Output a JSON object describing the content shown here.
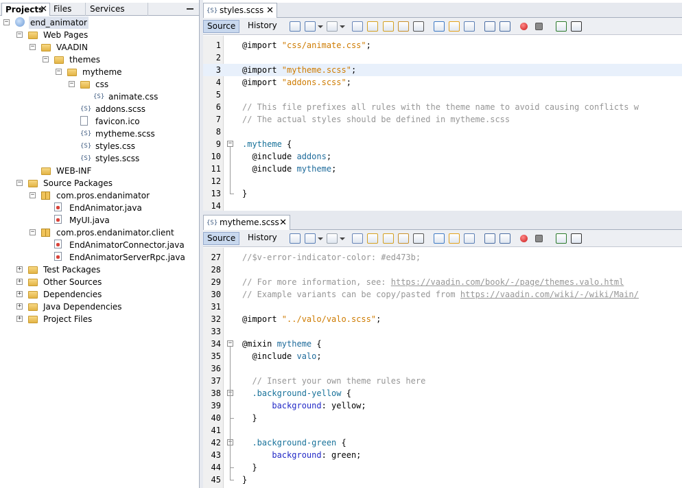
{
  "projects_panel": {
    "tabs": [
      "Projects",
      "Files",
      "Services"
    ],
    "close_glyph": "✕",
    "tree": [
      {
        "label": "end_animator",
        "indent": 0,
        "toggle": "−",
        "icon": "project",
        "selected": true
      },
      {
        "label": "Web Pages",
        "indent": 1,
        "toggle": "−",
        "icon": "folder-web"
      },
      {
        "label": "VAADIN",
        "indent": 2,
        "toggle": "−",
        "icon": "folder"
      },
      {
        "label": "themes",
        "indent": 3,
        "toggle": "−",
        "icon": "folder"
      },
      {
        "label": "mytheme",
        "indent": 4,
        "toggle": "−",
        "icon": "folder"
      },
      {
        "label": "css",
        "indent": 5,
        "toggle": "−",
        "icon": "folder"
      },
      {
        "label": "animate.css",
        "indent": 6,
        "toggle": "",
        "icon": "css-file"
      },
      {
        "label": "addons.scss",
        "indent": 5,
        "toggle": "",
        "icon": "scss-file"
      },
      {
        "label": "favicon.ico",
        "indent": 5,
        "toggle": "",
        "icon": "file"
      },
      {
        "label": "mytheme.scss",
        "indent": 5,
        "toggle": "",
        "icon": "scss-file"
      },
      {
        "label": "styles.css",
        "indent": 5,
        "toggle": "",
        "icon": "css-file"
      },
      {
        "label": "styles.scss",
        "indent": 5,
        "toggle": "",
        "icon": "scss-file"
      },
      {
        "label": "WEB-INF",
        "indent": 2,
        "toggle": "",
        "icon": "folder"
      },
      {
        "label": "Source Packages",
        "indent": 1,
        "toggle": "−",
        "icon": "folder-src"
      },
      {
        "label": "com.pros.endanimator",
        "indent": 2,
        "toggle": "−",
        "icon": "package"
      },
      {
        "label": "EndAnimator.java",
        "indent": 3,
        "toggle": "",
        "icon": "java-file"
      },
      {
        "label": "MyUI.java",
        "indent": 3,
        "toggle": "",
        "icon": "java-file"
      },
      {
        "label": "com.pros.endanimator.client",
        "indent": 2,
        "toggle": "−",
        "icon": "package"
      },
      {
        "label": "EndAnimatorConnector.java",
        "indent": 3,
        "toggle": "",
        "icon": "java-file"
      },
      {
        "label": "EndAnimatorServerRpc.java",
        "indent": 3,
        "toggle": "",
        "icon": "java-file"
      },
      {
        "label": "Test Packages",
        "indent": 1,
        "toggle": "+",
        "icon": "folder-test"
      },
      {
        "label": "Other Sources",
        "indent": 1,
        "toggle": "+",
        "icon": "folder-src"
      },
      {
        "label": "Dependencies",
        "indent": 1,
        "toggle": "+",
        "icon": "folder-lib"
      },
      {
        "label": "Java Dependencies",
        "indent": 1,
        "toggle": "+",
        "icon": "folder-lib"
      },
      {
        "label": "Project Files",
        "indent": 1,
        "toggle": "+",
        "icon": "folder-files"
      }
    ]
  },
  "editor_top": {
    "tab_title": "styles.scss",
    "source_label": "Source",
    "history_label": "History",
    "lines": [
      {
        "n": "1",
        "fold": "",
        "hl": false,
        "tokens": [
          [
            "kw",
            "@import "
          ],
          [
            "str",
            "\"css/animate.css\""
          ],
          [
            "kw",
            ";"
          ]
        ]
      },
      {
        "n": "2",
        "fold": "",
        "hl": false,
        "tokens": []
      },
      {
        "n": "3",
        "fold": "",
        "hl": true,
        "tokens": [
          [
            "kw",
            "@import "
          ],
          [
            "str",
            "\"mytheme.scss\""
          ],
          [
            "kw",
            ";"
          ]
        ]
      },
      {
        "n": "4",
        "fold": "",
        "hl": false,
        "tokens": [
          [
            "kw",
            "@import "
          ],
          [
            "str",
            "\"addons.scss\""
          ],
          [
            "kw",
            ";"
          ]
        ]
      },
      {
        "n": "5",
        "fold": "",
        "hl": false,
        "tokens": []
      },
      {
        "n": "6",
        "fold": "",
        "hl": false,
        "tokens": [
          [
            "cm",
            "// This file prefixes all rules with the theme name to avoid causing conflicts w"
          ]
        ]
      },
      {
        "n": "7",
        "fold": "",
        "hl": false,
        "tokens": [
          [
            "cm",
            "// The actual styles should be defined in mytheme.scss"
          ]
        ]
      },
      {
        "n": "8",
        "fold": "",
        "hl": false,
        "tokens": []
      },
      {
        "n": "9",
        "fold": "open",
        "hl": false,
        "tokens": [
          [
            "cls",
            ".mytheme"
          ],
          [
            "kw",
            " {"
          ]
        ]
      },
      {
        "n": "10",
        "fold": "",
        "hl": false,
        "tokens": [
          [
            "kw",
            "  @include "
          ],
          [
            "id",
            "addons"
          ],
          [
            "kw",
            ";"
          ]
        ]
      },
      {
        "n": "11",
        "fold": "",
        "hl": false,
        "tokens": [
          [
            "kw",
            "  @include "
          ],
          [
            "id",
            "mytheme"
          ],
          [
            "kw",
            ";"
          ]
        ]
      },
      {
        "n": "12",
        "fold": "",
        "hl": false,
        "tokens": []
      },
      {
        "n": "13",
        "fold": "end",
        "hl": false,
        "tokens": [
          [
            "kw",
            "}"
          ]
        ]
      },
      {
        "n": "14",
        "fold": "",
        "hl": false,
        "tokens": []
      }
    ]
  },
  "editor_bottom": {
    "tab_title": "mytheme.scss",
    "source_label": "Source",
    "history_label": "History",
    "lines": [
      {
        "n": "27",
        "fold": "",
        "hl": false,
        "tokens": [
          [
            "cm",
            "//$v-error-indicator-color: #ed473b;"
          ]
        ]
      },
      {
        "n": "28",
        "fold": "",
        "hl": false,
        "tokens": []
      },
      {
        "n": "29",
        "fold": "",
        "hl": false,
        "tokens": [
          [
            "cm",
            "// For more information, see: "
          ],
          [
            "url",
            "https://vaadin.com/book/-/page/themes.valo.html"
          ]
        ]
      },
      {
        "n": "30",
        "fold": "",
        "hl": false,
        "tokens": [
          [
            "cm",
            "// Example variants can be copy/pasted from "
          ],
          [
            "url",
            "https://vaadin.com/wiki/-/wiki/Main/"
          ]
        ]
      },
      {
        "n": "31",
        "fold": "",
        "hl": false,
        "tokens": []
      },
      {
        "n": "32",
        "fold": "",
        "hl": false,
        "tokens": [
          [
            "kw",
            "@import "
          ],
          [
            "str",
            "\"../valo/valo.scss\""
          ],
          [
            "kw",
            ";"
          ]
        ]
      },
      {
        "n": "33",
        "fold": "",
        "hl": false,
        "tokens": []
      },
      {
        "n": "34",
        "fold": "open",
        "hl": false,
        "tokens": [
          [
            "kw",
            "@mixin "
          ],
          [
            "id",
            "mytheme"
          ],
          [
            "kw",
            " {"
          ]
        ]
      },
      {
        "n": "35",
        "fold": "",
        "hl": false,
        "tokens": [
          [
            "kw",
            "  @include "
          ],
          [
            "id",
            "valo"
          ],
          [
            "kw",
            ";"
          ]
        ]
      },
      {
        "n": "36",
        "fold": "",
        "hl": false,
        "tokens": []
      },
      {
        "n": "37",
        "fold": "",
        "hl": false,
        "tokens": [
          [
            "cm",
            "  // Insert your own theme rules here"
          ]
        ]
      },
      {
        "n": "38",
        "fold": "open",
        "hl": false,
        "tokens": [
          [
            "cls",
            "  .background-yellow"
          ],
          [
            "kw",
            " {"
          ]
        ]
      },
      {
        "n": "39",
        "fold": "",
        "hl": false,
        "tokens": [
          [
            "prop",
            "      background"
          ],
          [
            "kw",
            ": yellow;"
          ]
        ]
      },
      {
        "n": "40",
        "fold": "end",
        "hl": false,
        "tokens": [
          [
            "kw",
            "  }"
          ]
        ]
      },
      {
        "n": "41",
        "fold": "",
        "hl": false,
        "tokens": []
      },
      {
        "n": "42",
        "fold": "open",
        "hl": false,
        "tokens": [
          [
            "cls",
            "  .background-green"
          ],
          [
            "kw",
            " {"
          ]
        ]
      },
      {
        "n": "43",
        "fold": "",
        "hl": false,
        "tokens": [
          [
            "prop",
            "      background"
          ],
          [
            "kw",
            ": green;"
          ]
        ]
      },
      {
        "n": "44",
        "fold": "end",
        "hl": false,
        "tokens": [
          [
            "kw",
            "  }"
          ]
        ]
      },
      {
        "n": "45",
        "fold": "end",
        "hl": false,
        "tokens": [
          [
            "kw",
            "}"
          ]
        ]
      }
    ]
  },
  "toolbar_icons": [
    "back-icon",
    "history-nav-icon",
    "dropdown-icon",
    "forward-icon",
    "dropdown-icon",
    "find-icon",
    "find-prev-icon",
    "find-next-icon",
    "toggle-highlight-icon",
    "select-icon",
    "prev-bookmark-icon",
    "next-bookmark-icon",
    "toggle-bookmark-icon",
    "shift-left-icon",
    "shift-right-icon",
    "record-macro-icon",
    "stop-macro-icon",
    "comment-icon",
    "uncomment-icon"
  ],
  "colors": {
    "accent": "#c8d8ee",
    "string": "#ce7b00",
    "comment": "#969696",
    "selector": "#18729a",
    "property": "#2229c7"
  }
}
